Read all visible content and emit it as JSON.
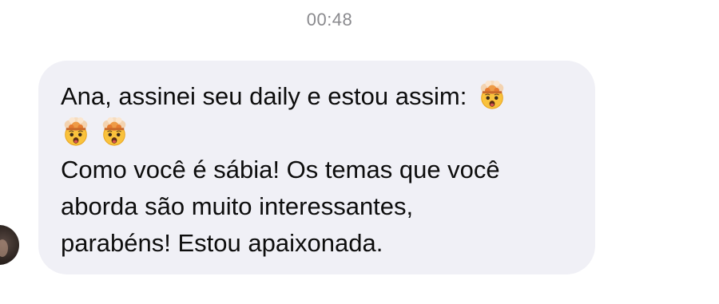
{
  "chat": {
    "timestamp": "00:48",
    "message": {
      "line1": "Ana, assinei seu daily e estou assim:",
      "line2": "Como você é sábia! Os temas que você",
      "line3": "aborda são muito interessantes,",
      "line4": "parabéns! Estou apaixonada.",
      "emojis": [
        "exploding-head-icon",
        "exploding-head-icon",
        "exploding-head-icon"
      ]
    }
  },
  "colors": {
    "bubble_bg": "#f0f0f6",
    "text": "#0d0d0d",
    "timestamp": "#8a8a8e"
  }
}
